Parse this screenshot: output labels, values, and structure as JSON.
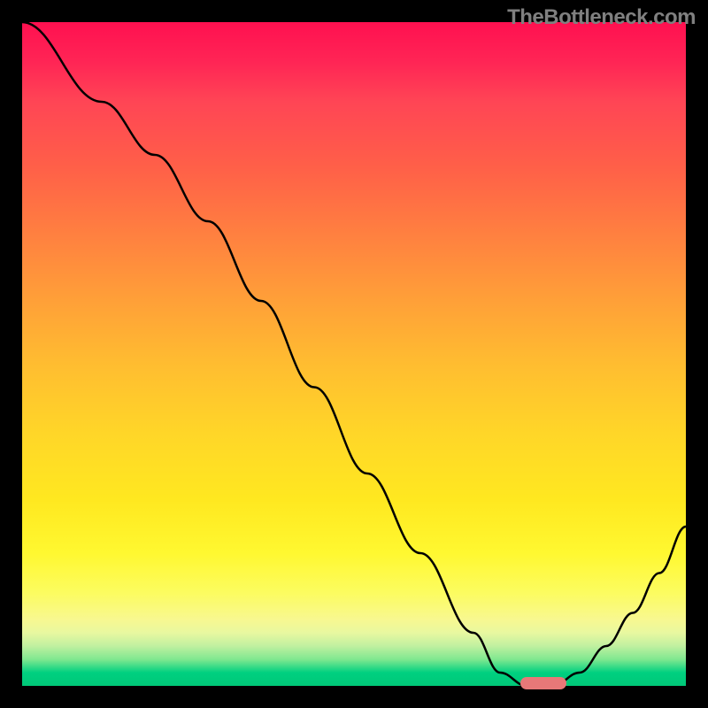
{
  "watermark": "TheBottleneck.com",
  "chart_data": {
    "type": "line",
    "title": "",
    "xlabel": "",
    "ylabel": "",
    "x_range": [
      0,
      100
    ],
    "y_range": [
      0,
      100
    ],
    "grid": false,
    "curve": {
      "description": "bottleneck metric — high red at left, decreasing to zero near x≈78, rising again toward right",
      "x": [
        0,
        12,
        20,
        28,
        36,
        44,
        52,
        60,
        68,
        72,
        76,
        80,
        84,
        88,
        92,
        96,
        100
      ],
      "y": [
        100,
        88,
        80,
        70,
        58,
        45,
        32,
        20,
        8,
        2,
        0,
        0,
        2,
        6,
        11,
        17,
        24
      ]
    },
    "optimum_marker": {
      "x_start": 75,
      "x_end": 82,
      "y": 0,
      "color": "#e87878"
    },
    "gradient_stops": [
      {
        "pos": 0,
        "color": "#ff1050",
        "meaning": "worst"
      },
      {
        "pos": 50,
        "color": "#ffc028",
        "meaning": "mid"
      },
      {
        "pos": 85,
        "color": "#fcfc60",
        "meaning": "good"
      },
      {
        "pos": 100,
        "color": "#00c878",
        "meaning": "best"
      }
    ]
  }
}
